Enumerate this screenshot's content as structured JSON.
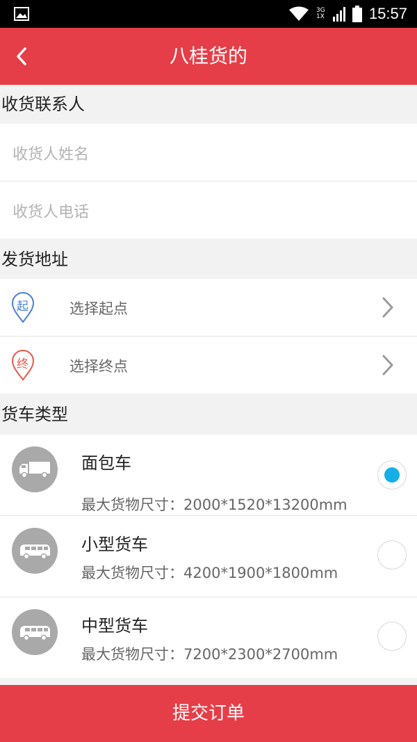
{
  "status_bar": {
    "time": "15:57",
    "network": "3G 1X",
    "icons": [
      "gallery-icon",
      "wifi-icon",
      "signal-icon",
      "battery-icon"
    ]
  },
  "header": {
    "title": "八桂货的",
    "back_icon": "chevron-left-icon",
    "background_color": "#e63e48"
  },
  "contact": {
    "section_title": "收货联系人",
    "name_placeholder": "收货人姓名",
    "phone_placeholder": "收货人电话"
  },
  "address": {
    "section_title": "发货地址",
    "start": {
      "badge": "起",
      "label": "选择起点",
      "color": "#4a7fd6"
    },
    "end": {
      "badge": "终",
      "label": "选择终点",
      "color": "#e8574c"
    }
  },
  "truck_types": {
    "section_title": "货车类型",
    "selected_color": "#16aee6",
    "items": [
      {
        "name": "面包车",
        "size": "最大货物尺寸：2000*1520*13200mm",
        "selected": true,
        "icon": "box-truck-icon"
      },
      {
        "name": "小型货车",
        "size": "最大货物尺寸：4200*1900*1800mm",
        "selected": false,
        "icon": "van-icon"
      },
      {
        "name": "中型货车",
        "size": "最大货物尺寸：7200*2300*2700mm",
        "selected": false,
        "icon": "van-icon"
      }
    ]
  },
  "submit": {
    "label": "提交订单"
  }
}
